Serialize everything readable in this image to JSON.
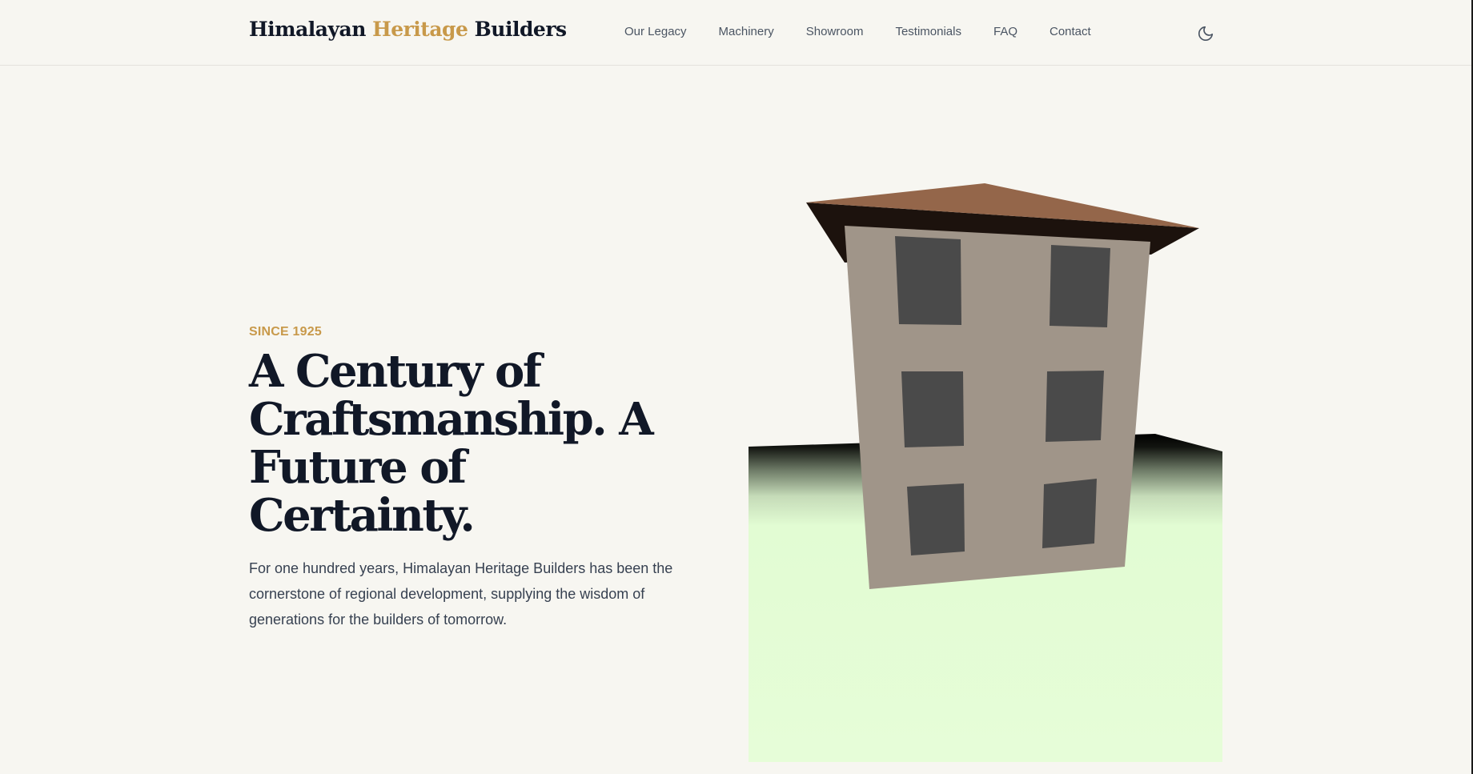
{
  "brand": {
    "name_part1": "Himalayan",
    "name_accent": "Heritage",
    "name_part2": "Builders"
  },
  "nav": {
    "items": [
      {
        "label": "Our Legacy"
      },
      {
        "label": "Machinery"
      },
      {
        "label": "Showroom"
      },
      {
        "label": "Testimonials"
      },
      {
        "label": "FAQ"
      },
      {
        "label": "Contact"
      }
    ]
  },
  "theme_toggle": {
    "icon": "moon-icon"
  },
  "hero": {
    "eyebrow": "SINCE 1925",
    "title": "A Century of Craftsmanship. A Future of Certainty.",
    "description": "For one hundred years, Himalayan Heritage Builders has been the cornerstone of regional development, supplying the wisdom of generations for the builders of tomorrow."
  },
  "colors": {
    "accent": "#c8994a",
    "background": "#f7f6f1",
    "text_dark": "#111827",
    "roof": "#94664a",
    "wall": "#a09589",
    "window": "#4a4a4a",
    "ground": "#e5fdd7"
  }
}
